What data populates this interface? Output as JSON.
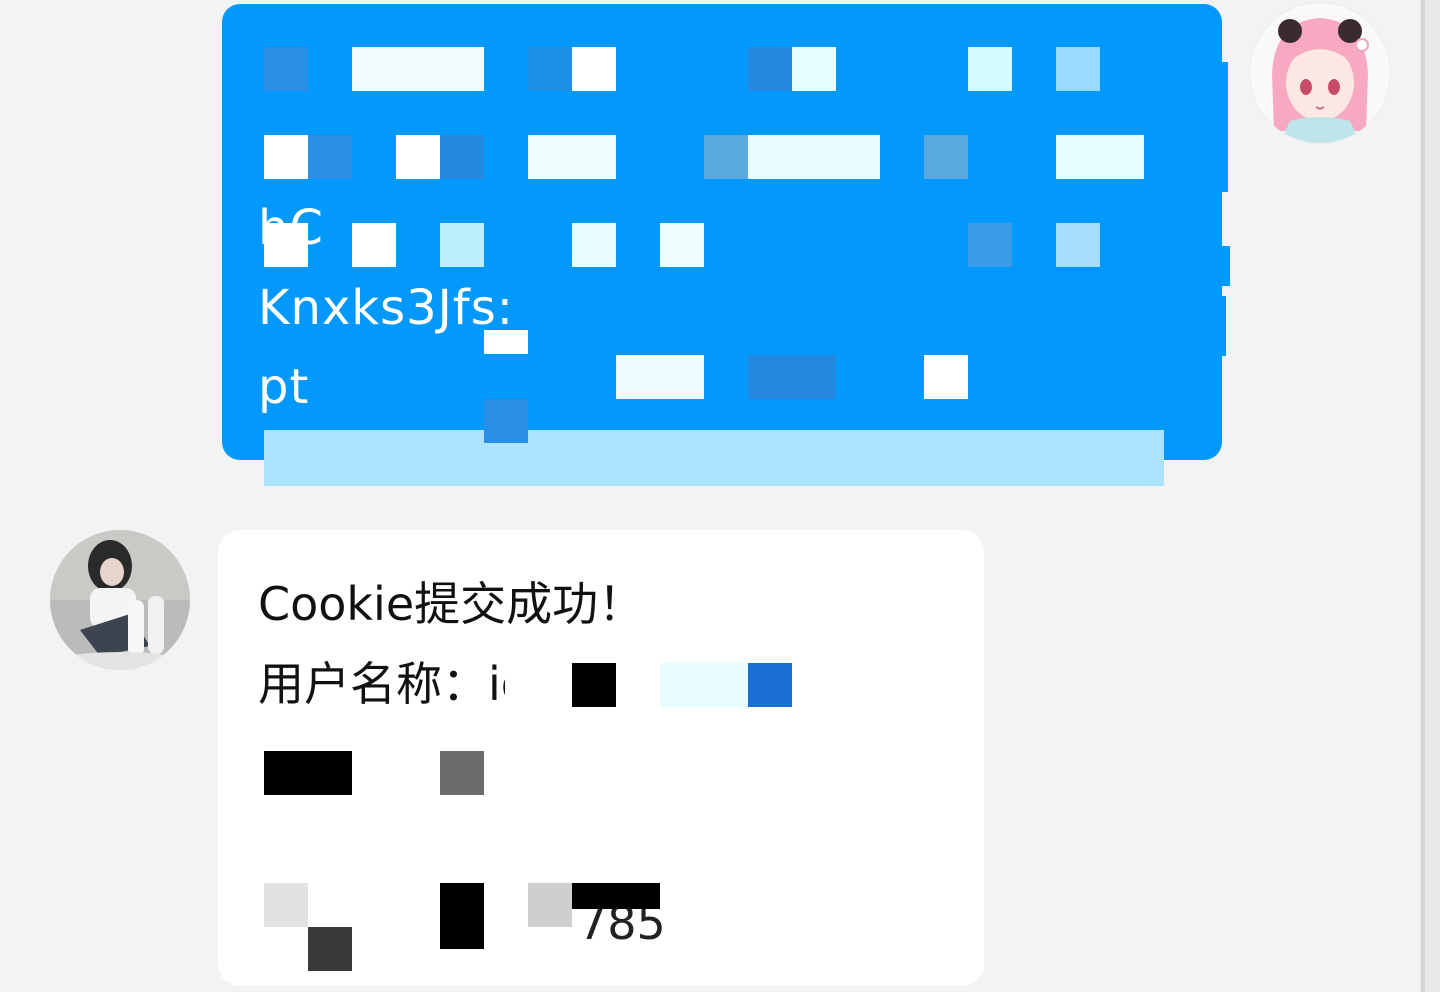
{
  "conversation": {
    "outgoing_message": {
      "lines": [
        "hC",
        "Knxks3Jfs:",
        "pt"
      ]
    },
    "incoming_message": {
      "title": "Cookie提交成功！",
      "username_label": "用户名称：",
      "username_fragment": "id",
      "trailing_fragment": "785"
    }
  },
  "colors": {
    "background": "#f3f3f3",
    "outgoing_bubble": "#0398fb",
    "incoming_bubble": "#ffffff",
    "redaction_light": "#e6fcff",
    "redaction_mid": "#2b8fe0",
    "redaction_black": "#000000"
  },
  "avatars": {
    "self": "anime-girl-pink-hair-avatar",
    "peer": "girl-photo-avatar"
  }
}
